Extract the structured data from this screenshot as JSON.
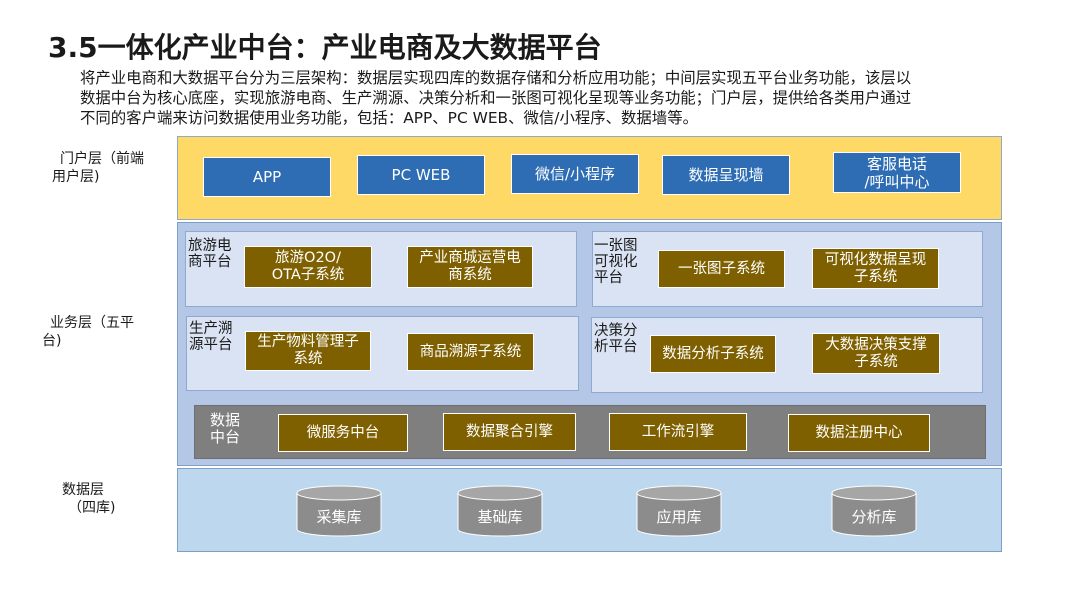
{
  "title": "3.5一体化产业中台：产业电商及大数据平台",
  "description": [
    "将产业电商和大数据平台分为三层架构：数据层实现四库的数据存储和分析应用功能；中间层实现五平台业务功能，该层以",
    "数据中台为核心底座，实现旅游电商、生产溯源、决策分析和一张图可视化呈现等业务功能；门户层，提供给各类用户通过",
    "不同的客户端来访问数据使用业务功能，包括：APP、PC WEB、微信/小程序、数据墙等。"
  ],
  "layers": {
    "portal": {
      "label_lines": [
        "门户层（前端",
        "用户层)"
      ],
      "items": [
        {
          "lines": [
            "APP"
          ]
        },
        {
          "lines": [
            "PC WEB"
          ]
        },
        {
          "lines": [
            "微信/小程序"
          ]
        },
        {
          "lines": [
            "数据呈现墙"
          ]
        },
        {
          "lines": [
            "客服电话",
            "/呼叫中心"
          ]
        }
      ]
    },
    "business": {
      "label_lines": [
        "业务层（五平",
        "台)"
      ],
      "platforms": [
        {
          "label_lines": [
            "旅游电",
            "商平台"
          ],
          "systems": [
            {
              "lines": [
                "旅游O2O/",
                "OTA子系统"
              ]
            },
            {
              "lines": [
                "产业商城运营电",
                "商系统"
              ]
            }
          ]
        },
        {
          "label_lines": [
            "一张图",
            "可视化",
            "平台"
          ],
          "systems": [
            {
              "lines": [
                "一张图子系统"
              ]
            },
            {
              "lines": [
                "可视化数据呈现",
                "子系统"
              ]
            }
          ]
        },
        {
          "label_lines": [
            "生产溯",
            "源平台"
          ],
          "systems": [
            {
              "lines": [
                "生产物料管理子",
                "系统"
              ]
            },
            {
              "lines": [
                "商品溯源子系统"
              ]
            }
          ]
        },
        {
          "label_lines": [
            "决策分",
            "析平台"
          ],
          "systems": [
            {
              "lines": [
                "数据分析子系统"
              ]
            },
            {
              "lines": [
                "大数据决策支撑",
                "子系统"
              ]
            }
          ]
        }
      ],
      "data_center": {
        "label_lines": [
          "数据",
          "中台"
        ],
        "items": [
          "微服务中台",
          "数据聚合引擎",
          "工作流引擎",
          "数据注册中心"
        ]
      }
    },
    "data": {
      "label_lines": [
        "数据层",
        "（四库)"
      ],
      "databases": [
        "采集库",
        "基础库",
        "应用库",
        "分析库"
      ]
    }
  },
  "colors": {
    "portal_band": "#ffd966",
    "business_band": "#b4c7e7",
    "data_band": "#bdd7ee",
    "blue_button": "#2e6db4",
    "gold_box": "#7f6000",
    "data_center": "#7f7f7f",
    "cylinder": "#8c8c8c"
  }
}
